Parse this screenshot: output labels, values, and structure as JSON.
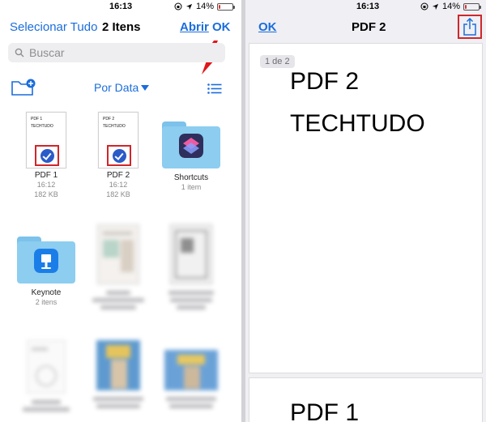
{
  "left": {
    "status": {
      "time": "16:13",
      "battery": "14%",
      "battery_level": 0.14
    },
    "nav": {
      "select_all": "Selecionar Tudo",
      "title": "2 Itens",
      "open": "Abrir",
      "done": "OK"
    },
    "search": {
      "placeholder": "Buscar"
    },
    "toolbar": {
      "sort_label": "Por Data"
    },
    "items": [
      {
        "name": "PDF 1",
        "thumb_line1": "PDF 1",
        "thumb_line2": "TECHTUDO",
        "time": "16:12",
        "size": "182 KB",
        "selected": true
      },
      {
        "name": "PDF 2",
        "thumb_line1": "PDF 2",
        "thumb_line2": "TECHTUDO",
        "time": "16:12",
        "size": "182 KB",
        "selected": true
      },
      {
        "name": "Shortcuts",
        "detail": "1 item",
        "icon": "shortcuts-app-icon"
      },
      {
        "name": "Keynote",
        "detail": "2 itens",
        "icon": "keynote-app-icon"
      }
    ],
    "colors": {
      "accent": "#1a6ddc",
      "highlight": "#d0262a",
      "folder": "#8ccdf0"
    }
  },
  "right": {
    "status": {
      "time": "16:13",
      "battery": "14%",
      "battery_level": 0.14
    },
    "nav": {
      "done": "OK",
      "title": "PDF 2"
    },
    "viewer": {
      "page_indicator": "1 de 2",
      "page1_line1": "PDF 2",
      "page1_line2": "TECHTUDO",
      "page2_line1": "PDF 1"
    }
  }
}
